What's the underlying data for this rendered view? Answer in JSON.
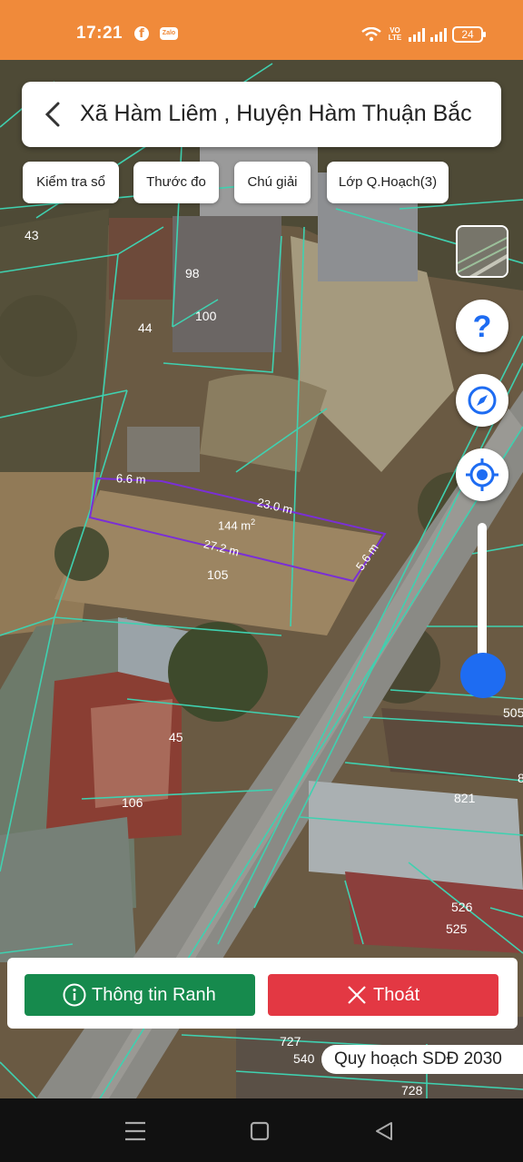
{
  "status_bar": {
    "time": "17:21",
    "volte": "VO LTE",
    "battery": "24",
    "icons": [
      "facebook-icon",
      "zalo-icon",
      "wifi-icon",
      "volte-icon",
      "signal-icon",
      "signal-icon",
      "battery-icon"
    ]
  },
  "header": {
    "title": "Xã Hàm Liêm , Huyện Hàm Thuận Bắc"
  },
  "toolbar": {
    "chips": [
      "Kiểm tra sổ",
      "Thước đo",
      "Chú giải",
      "Lớp Q.Hoạch(3)"
    ]
  },
  "map": {
    "parcel_labels": [
      "43",
      "98",
      "100",
      "44",
      "105",
      "45",
      "106",
      "821",
      "505",
      "8",
      "526",
      "525",
      "727",
      "540",
      "728"
    ],
    "measurement": {
      "top_left_edge": "6.6 m",
      "top_edge": "23.0 m",
      "area": "144 m",
      "area_unit_sup": "2",
      "bottom_edge": "27.2 m",
      "right_edge": "5.6 m"
    },
    "colors": {
      "parcel_line": "#3fd1b0",
      "measure_line": "#7a2fd6"
    }
  },
  "controls": {
    "icons": [
      "layer-thumbnail",
      "help-icon",
      "compass-icon",
      "locate-icon"
    ],
    "zoom_level_fraction": 0.85
  },
  "actions": {
    "info_label": "Thông tin Ranh",
    "exit_label": "Thoát",
    "info_color": "#168a4d",
    "exit_color": "#e33843"
  },
  "plan_label": "Quy hoạch SDĐ 2030",
  "nav": {
    "icons": [
      "menu-icon",
      "home-icon",
      "back-nav-icon"
    ]
  }
}
